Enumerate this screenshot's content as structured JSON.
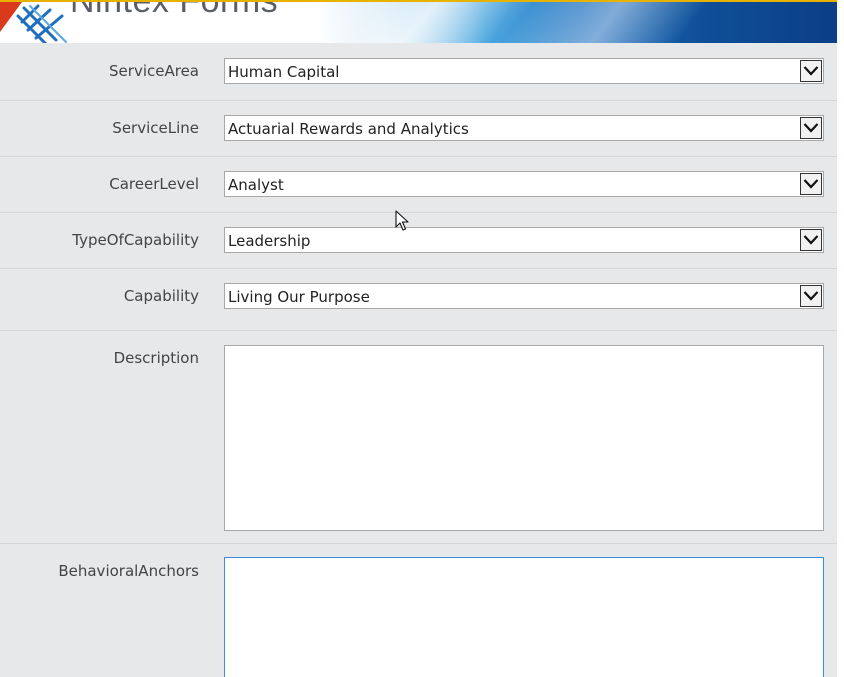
{
  "banner": {
    "title": "Nintex Forms",
    "colors": {
      "accent_top": "#e8b200",
      "blue_dark": "#0b3f86",
      "blue_mid": "#3ea0dc",
      "red": "#d93a1c"
    }
  },
  "form": {
    "fields": [
      {
        "label": "ServiceArea",
        "value": "Human Capital"
      },
      {
        "label": "ServiceLine",
        "value": "Actuarial Rewards and Analytics"
      },
      {
        "label": "CareerLevel",
        "value": "Analyst"
      },
      {
        "label": "TypeOfCapability",
        "value": "Leadership"
      },
      {
        "label": "Capability",
        "value": "Living Our Purpose"
      }
    ],
    "description": {
      "label": "Description",
      "value": ""
    },
    "behavioral_anchors": {
      "label": "BehavioralAnchors",
      "value": ""
    },
    "dropdown_icon": "chevron-down-icon",
    "colors": {
      "background": "#e6e8ea",
      "focus_border": "#3a8ddc"
    }
  }
}
